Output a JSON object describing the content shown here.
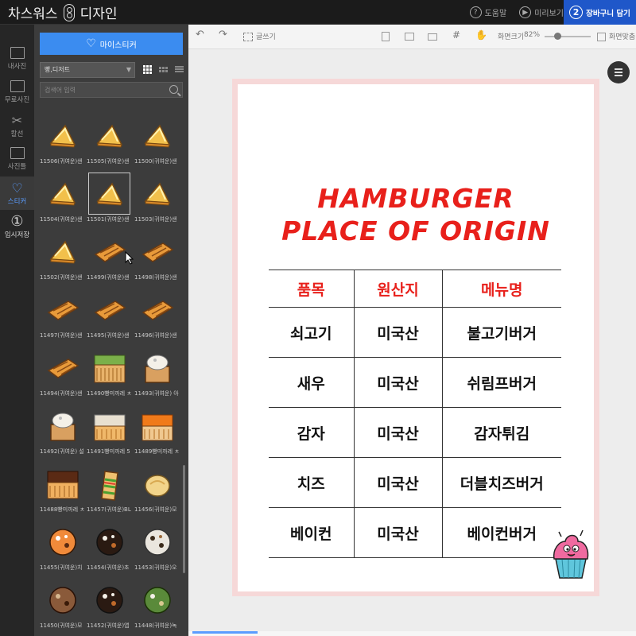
{
  "app": {
    "brand_left": "차스워스",
    "brand_right": "디자인"
  },
  "top_actions": [
    {
      "label": "도움말",
      "icon": "help-icon",
      "glyph": "?"
    },
    {
      "label": "미리보기",
      "icon": "preview-icon",
      "glyph": "▶"
    }
  ],
  "cart": {
    "number": "2",
    "label": "장바구니 담기"
  },
  "rail": [
    {
      "label": "내사진",
      "icon": "camera-icon"
    },
    {
      "label": "무료사진",
      "icon": "free-photo-icon"
    },
    {
      "label": "칼선",
      "icon": "scissors-icon"
    },
    {
      "label": "사진틀",
      "icon": "frame-icon"
    },
    {
      "label": "스티커",
      "icon": "heart-icon",
      "active": true
    },
    {
      "label": "임시저장",
      "icon": "temp-save-icon",
      "glyph": "①"
    }
  ],
  "panel": {
    "my_sticker_label": "마이스티커",
    "category_value": "빵,디저트",
    "search_placeholder": "검색어 입력"
  },
  "stickers": [
    {
      "caption": "11506(귀여운)샌",
      "kind": "sandwich"
    },
    {
      "caption": "11505(귀여운)샌",
      "kind": "sandwich"
    },
    {
      "caption": "11500(귀여운)샌",
      "kind": "sandwich"
    },
    {
      "caption": "11504(귀여운)샌",
      "kind": "sandwich"
    },
    {
      "caption": "11501(귀여운)샌",
      "kind": "sandwich",
      "selected": true
    },
    {
      "caption": "11503(귀여운)샌",
      "kind": "sandwich"
    },
    {
      "caption": "11502(귀여운)샌",
      "kind": "sandwich"
    },
    {
      "caption": "11499(귀여운)샌",
      "kind": "toast"
    },
    {
      "caption": "11498(귀여운)샌",
      "kind": "toast"
    },
    {
      "caption": "11497(귀여운)샌",
      "kind": "toast"
    },
    {
      "caption": "11495(귀여운)샌",
      "kind": "toast"
    },
    {
      "caption": "11496(귀여운)샌",
      "kind": "toast"
    },
    {
      "caption": "11494(귀여운)샌",
      "kind": "toast"
    },
    {
      "caption": "11490빵미까레 ㅊ",
      "kind": "cake-green"
    },
    {
      "caption": "11493(귀여운) 아",
      "kind": "box-cream"
    },
    {
      "caption": "11492(귀여운) 설",
      "kind": "box-cream"
    },
    {
      "caption": "11491빵미까레 5",
      "kind": "cake-sesame"
    },
    {
      "caption": "11489빵미까레 ㅊ",
      "kind": "cake-orange"
    },
    {
      "caption": "11488빵미까레 ㅊ",
      "kind": "cake-choco"
    },
    {
      "caption": "11457(귀여운)BL",
      "kind": "sub"
    },
    {
      "caption": "11456(귀여운)모",
      "kind": "bun"
    },
    {
      "caption": "11455(귀여운)치",
      "kind": "cookie-orange"
    },
    {
      "caption": "11454(귀여운)초",
      "kind": "cookie-dark"
    },
    {
      "caption": "11453(귀여운)오",
      "kind": "cookie-white"
    },
    {
      "caption": "11450(귀여운)모",
      "kind": "cookie-brown"
    },
    {
      "caption": "11452(귀여운)앱",
      "kind": "cookie-dark"
    },
    {
      "caption": "11448(귀여운)녹",
      "kind": "cookie-green"
    }
  ],
  "toolbar": {
    "text_tool": "글쓰기",
    "zoom_label": "화면크기",
    "zoom_value": "82%",
    "fit_label": "화면맞춤"
  },
  "poster": {
    "title_line1": "HAMBURGER",
    "title_line2": "PLACE OF ORIGIN",
    "headers": [
      "품목",
      "원산지",
      "메뉴명"
    ],
    "rows": [
      [
        "쇠고기",
        "미국산",
        "불고기버거"
      ],
      [
        "새우",
        "미국산",
        "쉬림프버거"
      ],
      [
        "감자",
        "미국산",
        "감자튀김"
      ],
      [
        "치즈",
        "미국산",
        "더블치즈버거"
      ],
      [
        "베이컨",
        "미국산",
        "베이컨버거"
      ]
    ]
  },
  "colors": {
    "accent_blue": "#1f57c9",
    "sticker_button": "#3b8cf0",
    "poster_red": "#e8201b"
  }
}
